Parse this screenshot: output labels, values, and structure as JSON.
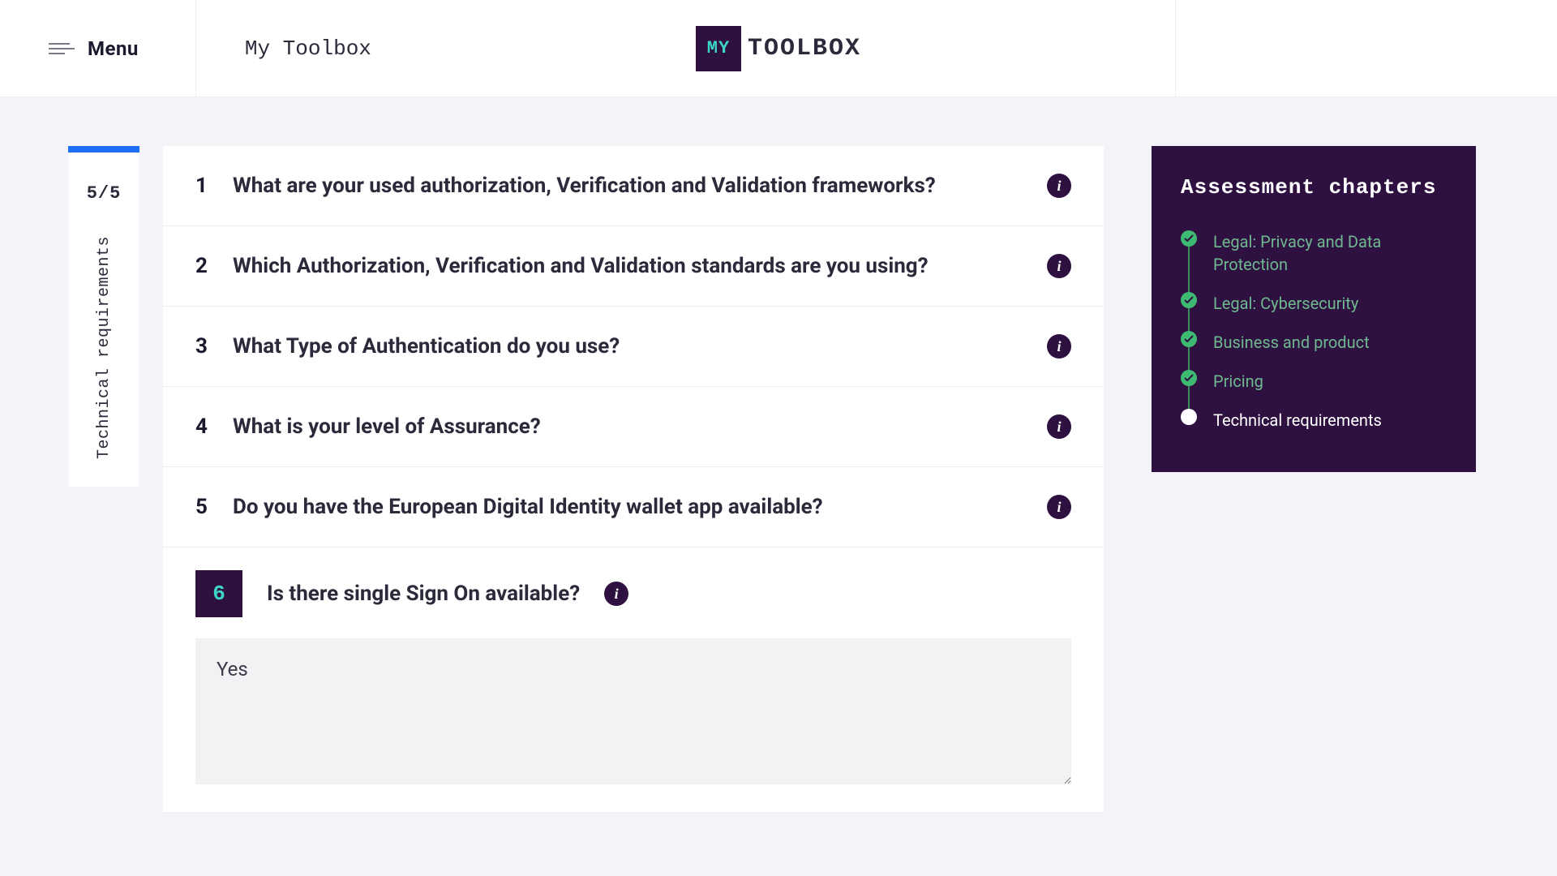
{
  "header": {
    "menu_label": "Menu",
    "breadcrumb": "My Toolbox",
    "logo_badge": "MY",
    "logo_text": "TOOLBOX"
  },
  "side_tab": {
    "count": "5/5",
    "label": "Technical requirements"
  },
  "questions": [
    {
      "num": "1",
      "text": "What are your used authorization, Verification and Validation frameworks?"
    },
    {
      "num": "2",
      "text": "Which Authorization, Verification and Validation standards are you using?"
    },
    {
      "num": "3",
      "text": "What Type of Authentication do you use?"
    },
    {
      "num": "4",
      "text": "What is your level of Assurance?"
    },
    {
      "num": "5",
      "text": "Do you have the European Digital Identity wallet app available?"
    }
  ],
  "active_question": {
    "num": "6",
    "text": "Is there single Sign On available?",
    "answer": "Yes"
  },
  "chapters": {
    "title": "Assessment chapters",
    "items": [
      {
        "label": "Legal: Privacy and Data Protection",
        "status": "done"
      },
      {
        "label": "Legal: Cybersecurity",
        "status": "done"
      },
      {
        "label": "Business and product",
        "status": "done"
      },
      {
        "label": "Pricing",
        "status": "done"
      },
      {
        "label": "Technical requirements",
        "status": "current"
      }
    ]
  }
}
